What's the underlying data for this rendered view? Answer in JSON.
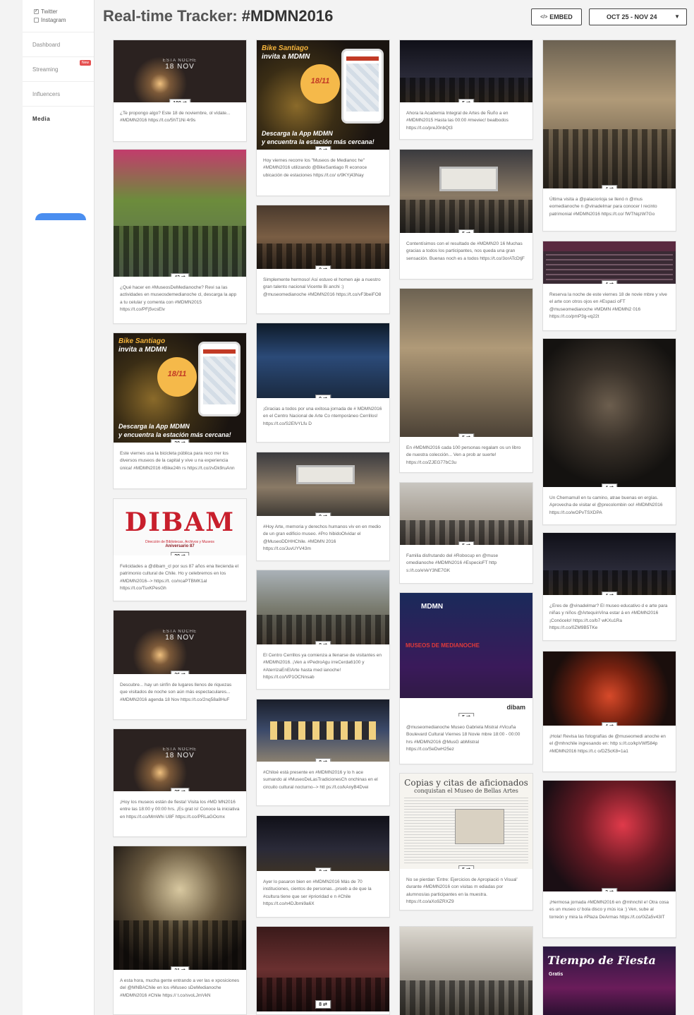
{
  "sidebar": {
    "sources": [
      {
        "label": "Twitter",
        "checked": true
      },
      {
        "label": "Instagram",
        "checked": false
      }
    ],
    "nav": [
      {
        "label": "Dashboard"
      },
      {
        "label": "Streaming",
        "badge": "New"
      },
      {
        "label": "Influencers"
      },
      {
        "label": "Media"
      }
    ]
  },
  "header": {
    "title_prefix": "Real-time Tracker:",
    "hashtag": "#MDMN2016",
    "embed_label": "EMBED",
    "embed_icon": "code-icon",
    "date_range": "OCT 25 - NOV 24",
    "date_caret": "▼"
  },
  "posts": {
    "c0": [
      {
        "count": "180",
        "caption": "¿Te propongo algo? Este 18 de noviembre, ol vídate... #MDMN2016 https://t.co/5hT1Ni 4r9s",
        "ph_title": "ESTA NOCHE",
        "ph_date": "18 NOV"
      },
      {
        "count": "43",
        "caption": "¿Qué hacer en #MuseosDeMedianoche? Revi sa las actividades en museosdemedianoche cl, descarga la app a tu celular y comenta con #MDMN2015 https://t.co/PFj5vcsElv"
      },
      {
        "count": "30",
        "caption": "Este viernes usa la bicicleta pública para reco rrer los diversos museos de la capital y vive u na experiencia única! #MDMN2016 #Bike24h rs https://t.co/zvDk9ruAnn",
        "ph_t1": "Bike Santiago",
        "ph_t2": "invita a MDMN",
        "ph_circle": "18/11",
        "ph_b1": "Descarga la App MDMN",
        "ph_b2": "y encuentra la estación más cercana!"
      },
      {
        "count": "29",
        "caption": "Felicidades a @dibam_cl por sus 87 años ena ltecienda el patrimonio cultural de Chile. Ho y celebremos en los #MDMN2016--> https://t. co/ncaPTBMK1al https://t.co/TsxKPesGh",
        "ph_logo": "DIBAM",
        "ph_sub": "Dirección de Bibliotecas, Archivos y Museos",
        "ph_ann": "Aniversario 87"
      },
      {
        "count": "26",
        "caption": "Descubre... hay un sinfín de lugares llenos de riquezas que visitados de noche son aún más espectaculares... #MDMN2016 agenda 18 Nov https://t.co/2nq58a8HuF",
        "ph_title": "ESTA NOCHE",
        "ph_date": "18 NOV"
      },
      {
        "count": "25",
        "caption": "¡Hoy los museos están de fiesta! Visita los #MD MN2016 entre las 18:00 y 00:00 hrs. ¡Es grat is! Conoce la iniciativa en https://t.co/MmWhi U8F https://t.co/PRLaGOcmx",
        "ph_title": "ESTA NOCHE",
        "ph_date": "18 NOV"
      },
      {
        "count": "21",
        "caption": "A esta hora, mucha gente entrando a ver las e xposiciones del @MNBAChile en los #Museo sDeMedianoche #MDMN2016 #Chile https:// t.co/svoLJmVkN"
      }
    ],
    "c1": [
      {
        "count": "9",
        "caption": "Hoy viernes recorre los \"Museos de Medianoc he\" #MDMN2016 utilizando @BikeSantiago R econoce ubicación de estaciones https://t.co/ o/9KYj43Nay",
        "ph_t1": "Bike Santiago",
        "ph_t2": "invita a MDMN",
        "ph_circle": "18/11",
        "ph_b1": "Descarga la App MDMN",
        "ph_b2": "y encuentra la estación más cercana!"
      },
      {
        "count": "9",
        "caption": "Simplemente hermoso! Así estuvo el homen aje a nuestro gran talento nacional Vicente Bi anchi :) @museomedianoche #MDMN2016 https://t.co/vF3beiFO8"
      },
      {
        "count": "9",
        "caption": "¡Gracias a todos por una exitosa jornada de # MDMN2016 en el Centro Nacional de Arte Co ntemporáneo Cerrillos! https://t.co/S2EfvYLfu D"
      },
      {
        "count": "9",
        "caption": "#Hoy Arte, memoria y derechos humanos viv en en medio de un gran edificio museo. #Pro hibidoOlvidar el @MuseoDDHHChile. #MDMN 2016 https://t.co/JuvUYV43m"
      },
      {
        "count": "8",
        "caption": "El Centro Cerrillos ya comienza a llenarse de visitantes en #MDMN2016. ¡Ven a #PedroAgu irreCerda6100 y #AterrizaEnElArte hasta med ianoche! https://t.co/VP1OCNnsab"
      },
      {
        "count": "8",
        "caption": "#Chiloé está presente en #MDMN2016 y lo h ace sumando al #MuseoDeLasTradicionesCh onchinas en el circuito cultural nocturno--> htt ps://t.co/kAnyB4Dvei"
      },
      {
        "count": "8",
        "caption": "Ayer lo pasaron bien en #MDMN2016 Más de 70 instituciones, cientos de personas...prueb a de que la #cultura tiene que ser #prioridad e n #Chile https://t.co/n4DJbmi9a6X"
      },
      {
        "count": "8",
        "caption": ""
      }
    ],
    "c2": [
      {
        "count": "5",
        "caption": "Ahora la Academia Integral de Artes de Ñuño a en #MDMN2015 Hasta las 00:00 #meviec! bealbodos https://t.co/preJ0nbQt3"
      },
      {
        "count": "5",
        "caption": "Contentísimos con el resultado de #MDMN20 16 Muchas gracias a todos los participantes, nos queda una gran sensación. Buenas noch es a todos https://t.co/3orATcDtjF"
      },
      {
        "count": "5",
        "caption": "En #MDMN2016 cada 100 personas regalam os un libro de nuestra colección... Ven a prob ar suerte! https://t.co/ZJEG77bC3u"
      },
      {
        "count": "5",
        "caption": "Familia disfrutando del #Robocup en @muse omedianoche #MDMN2016 #EspecioFT http s://t.co/eVeY3NE7GK"
      },
      {
        "count": "5",
        "caption": "@museomedianoche Museo Gabriela Mistral #Vicuña Boulevard Cultural Viernes 18 Novie mbre 18:00 - 00:00 hrs #MDMN2016 @MusG abMistral https://t.co/SeDwH25ez",
        "ph_tag": "MDMN",
        "ph_red": "MUSEOS DE MEDIANOCHE",
        "ph_bar": "dibam"
      },
      {
        "count": "5",
        "caption": "No se pierdan 'Entre: Ejercicios de Apropiació n Visual' durante #MDMN2016 con visitas m ediadas por alumnos/as participantes en la muestra. https://t.co/aXo9ZRXZ9",
        "ph_head": "Copias y citas de aficionados",
        "ph_head2": "conquistan el Museo de Bellas Artes"
      },
      {
        "count": "5",
        "caption": ""
      }
    ],
    "c3": [
      {
        "count": "4",
        "caption": "Última visita a @palaciorioja se llenó n @mus eomedianoche n @vinadelmar para conocer l recinto patrimonial #MDMN2016 https://t.co/ fWTNqzW7Go"
      },
      {
        "count": "4",
        "caption": "Reserva la noche de este viernes 18 de novie mbre y vive el arte con otros ojos en #Espaci oFT @museomedianoche #MDMN #MDMN2 016 https://t.co/pmP3g-vq22t"
      },
      {
        "count": "4",
        "caption": "Un Chemamull en tu camino, atrae buenas en ergías. Aprovecha de visitar el @precolombin oo! #MDMN2016 https://t.co/wOPvTSXDPA"
      },
      {
        "count": "4",
        "caption": "¿Eres de @vinadelmar? El museo educativo d e arte para niñas y niños @ArtequinVina estar á en #MDMN2016 ¡Conócelo! https://t.co/b7 wKXu1Ra https://t.co/0ZM9B5TKe"
      },
      {
        "count": "4",
        "caption": "¡Hola! Revisa las fotografías de @museomedi anoche en el @mhnchile ingresando en: http s://t.co/kpVWf584p #MDMN2016 https://t.c o/DZ5cK8=1a1"
      },
      {
        "count": "3",
        "caption": "¡Hermosa jornada #MDMN2016 en @mhnchil e! Otra cosa es un museo c/ bola disco y mús ica :) Ven, sube al torreón y mira la #Plaza DeArmas https://t.co/0iZa5v43IT"
      },
      {
        "count": "",
        "caption": "",
        "ph_t": "Tiempo de Fiesta",
        "ph_g": "Gratis"
      }
    ]
  }
}
